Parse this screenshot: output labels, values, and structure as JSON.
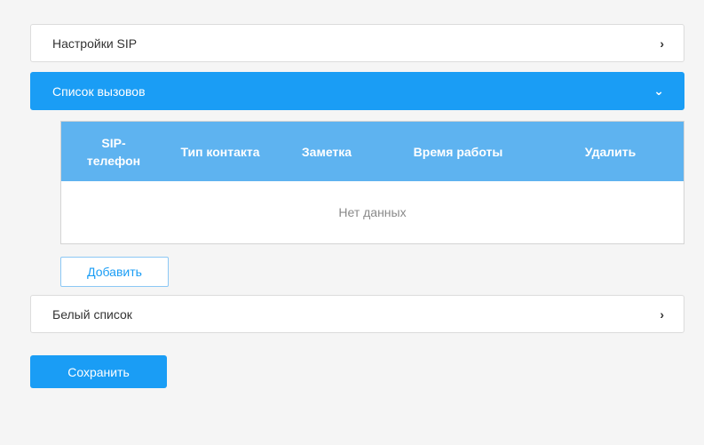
{
  "accordion": {
    "sip_settings": {
      "label": "Настройки SIP",
      "chevron": "›"
    },
    "call_list": {
      "label": "Список вызовов",
      "chevron": "⌄"
    },
    "white_list": {
      "label": "Белый список",
      "chevron": "›"
    }
  },
  "table": {
    "columns": [
      "SIP-\nтелефон",
      "Тип контакта",
      "Заметка",
      "Время работы",
      "Удалить"
    ],
    "empty_text": "Нет данных"
  },
  "buttons": {
    "add": "Добавить",
    "save": "Сохранить"
  },
  "colors": {
    "accent": "#1a9df5",
    "table_header": "#5eb3f0"
  }
}
